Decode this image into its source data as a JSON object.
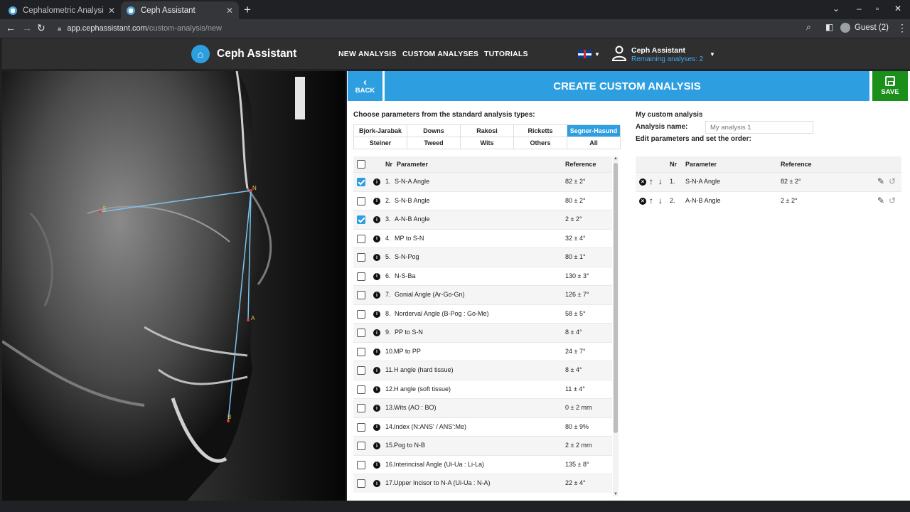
{
  "browser": {
    "tabs": [
      {
        "title": "Cephalometric Analysis |",
        "active": false
      },
      {
        "title": "Ceph Assistant",
        "active": true
      }
    ],
    "url_host": "app.cephassistant.com",
    "url_path": "/custom-analysis/new",
    "profile": "Guest (2)"
  },
  "header": {
    "brand": "Ceph Assistant",
    "nav": [
      "NEW ANALYSIS",
      "CUSTOM ANALYSES",
      "TUTORIALS"
    ],
    "user_name": "Ceph Assistant",
    "remaining": "Remaining analyses: 2"
  },
  "xray": {
    "landmarks": [
      "S",
      "N",
      "A",
      "B"
    ]
  },
  "panel": {
    "back": "BACK",
    "title": "CREATE CUSTOM ANALYSIS",
    "save": "SAVE",
    "choose_label": "Choose parameters from the standard analysis types:",
    "types": [
      "Bjork-Jarabak",
      "Downs",
      "Rakosi",
      "Ricketts",
      "Segner-Hasund",
      "Steiner",
      "Tweed",
      "Wits",
      "Others",
      "All"
    ],
    "active_type": "Segner-Hasund",
    "columns": {
      "nr": "Nr",
      "parameter": "Parameter",
      "reference": "Reference"
    },
    "parameters": [
      {
        "nr": "1.",
        "name": "S-N-A Angle",
        "ref": "82 ± 2°",
        "checked": true
      },
      {
        "nr": "2.",
        "name": "S-N-B Angle",
        "ref": "80 ± 2°",
        "checked": false
      },
      {
        "nr": "3.",
        "name": "A-N-B Angle",
        "ref": "2 ± 2°",
        "checked": true
      },
      {
        "nr": "4.",
        "name": "MP to S-N",
        "ref": "32 ± 4°",
        "checked": false
      },
      {
        "nr": "5.",
        "name": "S-N-Pog",
        "ref": "80 ± 1°",
        "checked": false
      },
      {
        "nr": "6.",
        "name": "N-S-Ba",
        "ref": "130 ± 3°",
        "checked": false
      },
      {
        "nr": "7.",
        "name": "Gonial Angle (Ar-Go-Gn)",
        "ref": "126 ± 7°",
        "checked": false
      },
      {
        "nr": "8.",
        "name": "Norderval Angle (B-Pog : Go-Me)",
        "ref": "58 ± 5°",
        "checked": false
      },
      {
        "nr": "9.",
        "name": "PP to S-N",
        "ref": "8 ± 4°",
        "checked": false
      },
      {
        "nr": "10.",
        "name": "MP to PP",
        "ref": "24 ± 7°",
        "checked": false
      },
      {
        "nr": "11.",
        "name": "H angle (hard tissue)",
        "ref": "8 ± 4°",
        "checked": false
      },
      {
        "nr": "12.",
        "name": "H angle (soft tissue)",
        "ref": "11 ± 4°",
        "checked": false
      },
      {
        "nr": "13.",
        "name": "Wits (AO : BO)",
        "ref": "0 ± 2 mm",
        "checked": false
      },
      {
        "nr": "14.",
        "name": "Index (N:ANS' / ANS':Me)",
        "ref": "80 ± 9%",
        "checked": false
      },
      {
        "nr": "15.",
        "name": "Pog to N-B",
        "ref": "2 ± 2 mm",
        "checked": false
      },
      {
        "nr": "16.",
        "name": "Interincisal Angle (Ui-Ua : Li-La)",
        "ref": "135 ± 8°",
        "checked": false
      },
      {
        "nr": "17.",
        "name": "Upper Incisor to N-A (Ui-Ua : N-A)",
        "ref": "22 ± 4°",
        "checked": false
      }
    ],
    "my_label": "My custom analysis",
    "name_label": "Analysis name:",
    "name_placeholder": "My analysis 1",
    "edit_label": "Edit parameters and set the order:",
    "selected": [
      {
        "nr": "1.",
        "name": "S-N-A Angle",
        "ref": "82 ± 2°"
      },
      {
        "nr": "2.",
        "name": "A-N-B Angle",
        "ref": "2 ± 2°"
      }
    ]
  },
  "colors": {
    "accent": "#2d9ee0",
    "save": "#1a8f1a",
    "header": "#2f2f2f"
  }
}
